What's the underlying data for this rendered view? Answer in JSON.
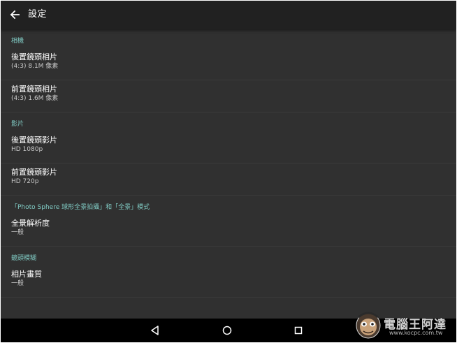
{
  "app_bar": {
    "title": "設定",
    "back_icon": "arrow-back-icon"
  },
  "colors": {
    "background": "#303030",
    "app_bar": "#212121",
    "section_header": "#80cbc4",
    "primary_text": "#ffffff",
    "secondary_text": "#c8c8c8"
  },
  "sections": [
    {
      "header": "相機",
      "items": [
        {
          "title": "後置鏡頭相片",
          "summary": "(4:3) 8.1M 像素"
        },
        {
          "title": "前置鏡頭相片",
          "summary": "(4:3) 1.6M 像素"
        }
      ]
    },
    {
      "header": "影片",
      "items": [
        {
          "title": "後置鏡頭影片",
          "summary": "HD 1080p"
        },
        {
          "title": "前置鏡頭影片",
          "summary": "HD 720p"
        }
      ]
    },
    {
      "header": "「Photo Sphere 球形全景拍攝」和「全景」模式",
      "items": [
        {
          "title": "全景解析度",
          "summary": "一般"
        }
      ]
    },
    {
      "header": "鏡頭模糊",
      "items": [
        {
          "title": "相片畫質",
          "summary": "一般"
        }
      ]
    }
  ],
  "nav_bar": {
    "back_icon": "triangle-back-icon",
    "home_icon": "circle-home-icon",
    "recents_icon": "square-recents-icon"
  },
  "watermark": {
    "text": "電腦王阿達",
    "url": "www.kocpc.com.tw"
  }
}
